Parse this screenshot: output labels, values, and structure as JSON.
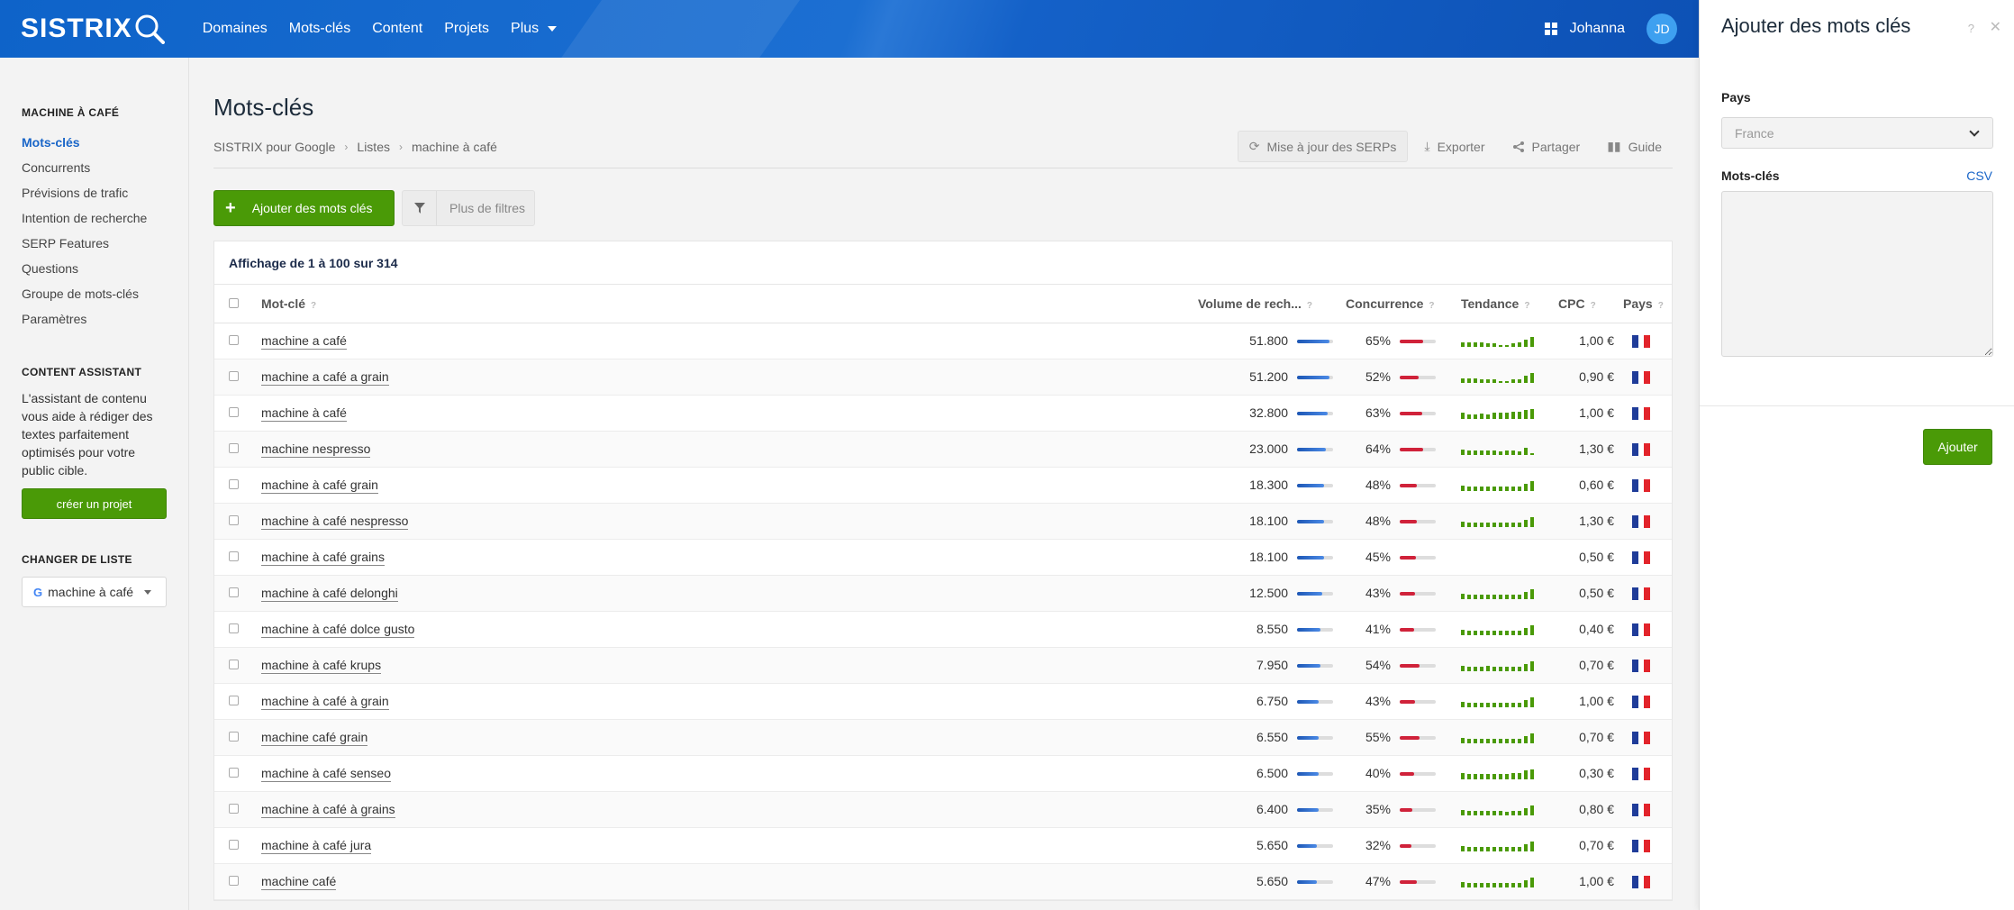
{
  "header": {
    "logo_text": "SISTRIX",
    "nav": [
      {
        "label": "Domaines"
      },
      {
        "label": "Mots-clés"
      },
      {
        "label": "Content"
      },
      {
        "label": "Projets"
      },
      {
        "label": "Plus"
      }
    ],
    "username": "Johanna",
    "avatar_initials": "JD"
  },
  "sidebar": {
    "list_heading": "MACHINE À CAFÉ",
    "links": [
      {
        "label": "Mots-clés",
        "active": true
      },
      {
        "label": "Concurrents"
      },
      {
        "label": "Prévisions de trafic"
      },
      {
        "label": "Intention de recherche"
      },
      {
        "label": "SERP Features"
      },
      {
        "label": "Questions"
      },
      {
        "label": "Groupe de mots-clés"
      },
      {
        "label": "Paramètres"
      }
    ],
    "content_assistant": {
      "heading": "CONTENT ASSISTANT",
      "text": "L'assistant de contenu vous aide à rédiger des textes parfaitement optimisés pour votre public cible.",
      "button": "créer un projet"
    },
    "change_list": {
      "heading": "CHANGER DE LISTE",
      "selected": "machine à café",
      "engine_letter": "G"
    }
  },
  "main": {
    "title": "Mots-clés",
    "breadcrumb": [
      "SISTRIX pour Google",
      "Listes",
      "machine à café"
    ],
    "actions": {
      "update": "Mise à jour des SERPs",
      "export": "Exporter",
      "share": "Partager",
      "guide": "Guide"
    },
    "add_button": "Ajouter des mots clés",
    "filter_button": "Plus de filtres",
    "summary": "Affichage de 1 à 100 sur 314",
    "columns": {
      "keyword": "Mot-clé",
      "volume": "Volume de rech...",
      "competition": "Concurrence",
      "trend": "Tendance",
      "cpc": "CPC",
      "country": "Pays",
      "help": "?"
    },
    "rows": [
      {
        "keyword": "machine a café",
        "volume": "51.800",
        "vol_level": 0.9,
        "competition": "65%",
        "comp_level": 0.65,
        "trend": [
          0.4,
          0.4,
          0.4,
          0.4,
          0.3,
          0.3,
          0.2,
          0.2,
          0.3,
          0.4,
          0.7,
          0.9
        ],
        "cpc": "1,00 €"
      },
      {
        "keyword": "machine a café a grain",
        "volume": "51.200",
        "vol_level": 0.9,
        "competition": "52%",
        "comp_level": 0.52,
        "trend": [
          0.4,
          0.4,
          0.4,
          0.3,
          0.3,
          0.3,
          0.2,
          0.2,
          0.3,
          0.3,
          0.7,
          0.9
        ],
        "cpc": "0,90 €"
      },
      {
        "keyword": "machine à café",
        "volume": "32.800",
        "vol_level": 0.85,
        "competition": "63%",
        "comp_level": 0.63,
        "trend": [
          0.6,
          0.4,
          0.4,
          0.5,
          0.4,
          0.6,
          0.6,
          0.6,
          0.7,
          0.7,
          0.8,
          0.9
        ],
        "cpc": "1,00 €"
      },
      {
        "keyword": "machine nespresso",
        "volume": "23.000",
        "vol_level": 0.8,
        "competition": "64%",
        "comp_level": 0.64,
        "trend": [
          0.5,
          0.4,
          0.4,
          0.4,
          0.4,
          0.4,
          0.3,
          0.4,
          0.4,
          0.3,
          0.7,
          0.2
        ],
        "cpc": "1,30 €"
      },
      {
        "keyword": "machine à café grain",
        "volume": "18.300",
        "vol_level": 0.75,
        "competition": "48%",
        "comp_level": 0.48,
        "trend": [
          0.5,
          0.4,
          0.4,
          0.4,
          0.4,
          0.4,
          0.4,
          0.4,
          0.4,
          0.4,
          0.7,
          0.9
        ],
        "cpc": "0,60 €"
      },
      {
        "keyword": "machine à café nespresso",
        "volume": "18.100",
        "vol_level": 0.75,
        "competition": "48%",
        "comp_level": 0.48,
        "trend": [
          0.5,
          0.4,
          0.4,
          0.4,
          0.4,
          0.4,
          0.4,
          0.4,
          0.4,
          0.4,
          0.7,
          0.9
        ],
        "cpc": "1,30 €"
      },
      {
        "keyword": "machine à café grains",
        "volume": "18.100",
        "vol_level": 0.75,
        "competition": "45%",
        "comp_level": 0.45,
        "trend": [],
        "cpc": "0,50 €"
      },
      {
        "keyword": "machine à café delonghi",
        "volume": "12.500",
        "vol_level": 0.7,
        "competition": "43%",
        "comp_level": 0.43,
        "trend": [
          0.5,
          0.4,
          0.4,
          0.4,
          0.4,
          0.4,
          0.4,
          0.4,
          0.4,
          0.4,
          0.7,
          0.9
        ],
        "cpc": "0,50 €"
      },
      {
        "keyword": "machine à café dolce gusto",
        "volume": "8.550",
        "vol_level": 0.65,
        "competition": "41%",
        "comp_level": 0.41,
        "trend": [
          0.5,
          0.4,
          0.4,
          0.4,
          0.4,
          0.4,
          0.4,
          0.4,
          0.4,
          0.4,
          0.7,
          0.9
        ],
        "cpc": "0,40 €"
      },
      {
        "keyword": "machine à café krups",
        "volume": "7.950",
        "vol_level": 0.65,
        "competition": "54%",
        "comp_level": 0.54,
        "trend": [
          0.5,
          0.4,
          0.4,
          0.4,
          0.5,
          0.4,
          0.4,
          0.4,
          0.4,
          0.4,
          0.7,
          0.9
        ],
        "cpc": "0,70 €"
      },
      {
        "keyword": "machine à café à grain",
        "volume": "6.750",
        "vol_level": 0.6,
        "competition": "43%",
        "comp_level": 0.43,
        "trend": [
          0.5,
          0.4,
          0.4,
          0.4,
          0.4,
          0.4,
          0.4,
          0.4,
          0.4,
          0.4,
          0.7,
          0.9
        ],
        "cpc": "1,00 €"
      },
      {
        "keyword": "machine café grain",
        "volume": "6.550",
        "vol_level": 0.6,
        "competition": "55%",
        "comp_level": 0.55,
        "trend": [
          0.5,
          0.4,
          0.4,
          0.4,
          0.4,
          0.4,
          0.4,
          0.4,
          0.4,
          0.4,
          0.7,
          0.9
        ],
        "cpc": "0,70 €"
      },
      {
        "keyword": "machine à café senseo",
        "volume": "6.500",
        "vol_level": 0.6,
        "competition": "40%",
        "comp_level": 0.4,
        "trend": [
          0.6,
          0.5,
          0.5,
          0.5,
          0.5,
          0.5,
          0.5,
          0.5,
          0.6,
          0.6,
          0.8,
          0.9
        ],
        "cpc": "0,30 €"
      },
      {
        "keyword": "machine à café à grains",
        "volume": "6.400",
        "vol_level": 0.6,
        "competition": "35%",
        "comp_level": 0.35,
        "trend": [
          0.5,
          0.4,
          0.4,
          0.4,
          0.4,
          0.4,
          0.4,
          0.3,
          0.4,
          0.4,
          0.7,
          0.9
        ],
        "cpc": "0,80 €"
      },
      {
        "keyword": "machine à café jura",
        "volume": "5.650",
        "vol_level": 0.55,
        "competition": "32%",
        "comp_level": 0.32,
        "trend": [
          0.5,
          0.4,
          0.4,
          0.4,
          0.4,
          0.4,
          0.4,
          0.4,
          0.4,
          0.4,
          0.7,
          0.9
        ],
        "cpc": "0,70 €"
      },
      {
        "keyword": "machine café",
        "volume": "5.650",
        "vol_level": 0.55,
        "competition": "47%",
        "comp_level": 0.47,
        "trend": [
          0.5,
          0.4,
          0.4,
          0.4,
          0.4,
          0.4,
          0.4,
          0.4,
          0.4,
          0.4,
          0.7,
          0.9
        ],
        "cpc": "1,00 €"
      }
    ]
  },
  "drawer": {
    "title": "Ajouter des mots clés",
    "help": "?",
    "close": "✕",
    "country_label": "Pays",
    "country_value": "France",
    "keywords_label": "Mots-clés",
    "csv_link": "CSV",
    "keywords_value": "",
    "submit": "Ajouter"
  },
  "colors": {
    "brand_blue": "#1461c8",
    "accent_green": "#4a9a07",
    "link_blue": "#1a66c8",
    "competition_red": "#d0223a",
    "flag": [
      "#1f3c99",
      "#ffffff",
      "#e2242b"
    ]
  }
}
